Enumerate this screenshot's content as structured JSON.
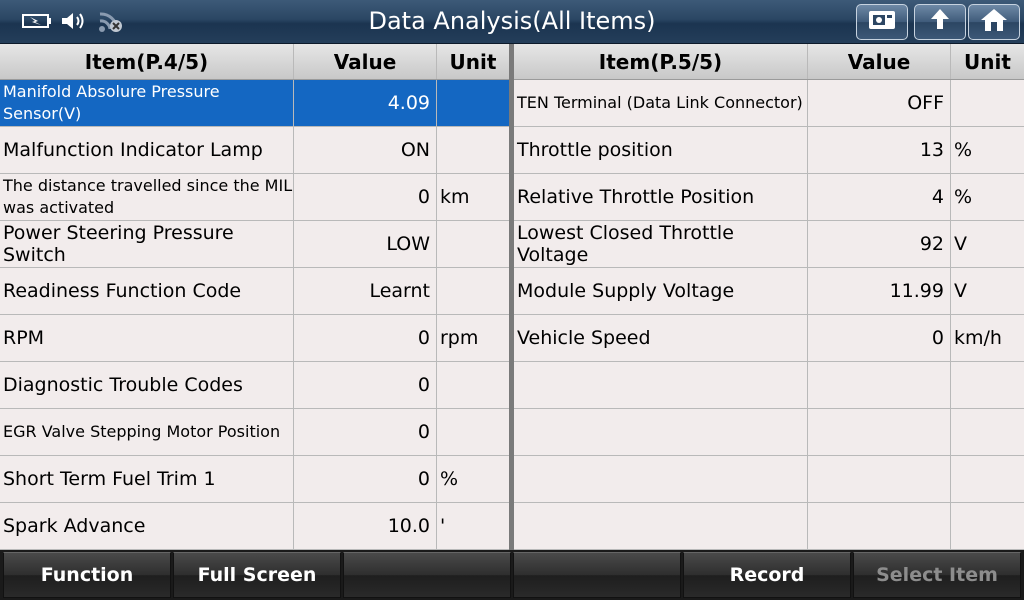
{
  "title": "Data Analysis(All Items)",
  "status_icons": [
    "battery-icon",
    "speaker-icon",
    "wifi-icon"
  ],
  "nav_buttons": [
    "screenshot-icon",
    "back-icon",
    "home-icon"
  ],
  "left_table": {
    "headers": [
      "Item(P.4/5)",
      "Value",
      "Unit"
    ],
    "rows": [
      {
        "item": "Manifold Absolure Pressure Sensor(V)",
        "value": "4.09",
        "unit": ""
      },
      {
        "item": "Malfunction Indicator Lamp",
        "value": "ON",
        "unit": ""
      },
      {
        "item": "The distance travelled since the MIL was activated",
        "value": "0",
        "unit": "km"
      },
      {
        "item": "Power Steering Pressure Switch",
        "value": "LOW",
        "unit": ""
      },
      {
        "item": "Readiness Function Code",
        "value": "Learnt",
        "unit": ""
      },
      {
        "item": "RPM",
        "value": "0",
        "unit": "rpm"
      },
      {
        "item": "Diagnostic Trouble Codes",
        "value": "0",
        "unit": ""
      },
      {
        "item": "EGR Valve Stepping Motor Position",
        "value": "0",
        "unit": ""
      },
      {
        "item": "Short Term Fuel Trim 1",
        "value": "0",
        "unit": "%"
      },
      {
        "item": "Spark Advance",
        "value": "10.0",
        "unit": "'"
      }
    ]
  },
  "right_table": {
    "headers": [
      "Item(P.5/5)",
      "Value",
      "Unit"
    ],
    "rows": [
      {
        "item": "TEN Terminal (Data Link Connector)",
        "value": "OFF",
        "unit": ""
      },
      {
        "item": "Throttle position",
        "value": "13",
        "unit": "%"
      },
      {
        "item": "Relative Throttle Position",
        "value": "4",
        "unit": "%"
      },
      {
        "item": "Lowest Closed Throttle Voltage",
        "value": "92",
        "unit": "V"
      },
      {
        "item": "Module Supply Voltage",
        "value": "11.99",
        "unit": "V"
      },
      {
        "item": "Vehicle Speed",
        "value": "0",
        "unit": "km/h"
      },
      {
        "item": "",
        "value": "",
        "unit": ""
      },
      {
        "item": "",
        "value": "",
        "unit": ""
      },
      {
        "item": "",
        "value": "",
        "unit": ""
      },
      {
        "item": "",
        "value": "",
        "unit": ""
      }
    ]
  },
  "bottom_buttons": [
    {
      "label": "Function",
      "enabled": true
    },
    {
      "label": "Full Screen",
      "enabled": true
    },
    {
      "label": "",
      "enabled": true
    },
    {
      "label": "",
      "enabled": true
    },
    {
      "label": "Record",
      "enabled": true
    },
    {
      "label": "Select Item",
      "enabled": false
    }
  ],
  "colors": {
    "selected_row": "#1467c2",
    "title_bar": "#2a4663"
  }
}
